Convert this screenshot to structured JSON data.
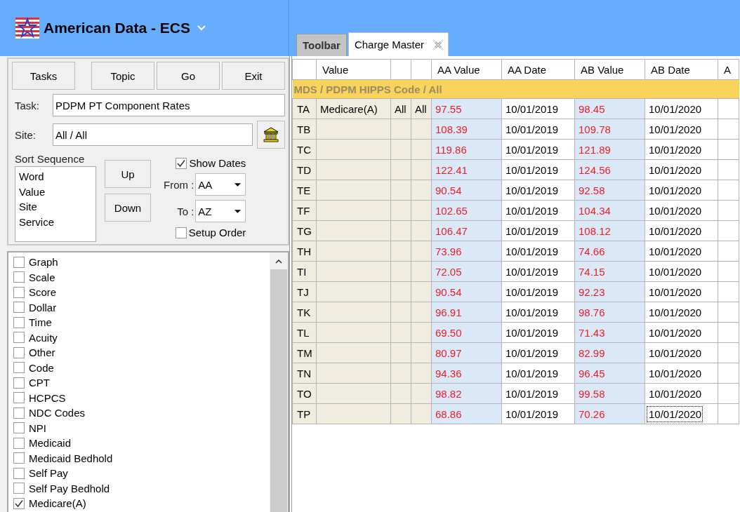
{
  "app": {
    "title": "American Data - ECS"
  },
  "tabs": [
    {
      "label": "Toolbar",
      "selected": false,
      "closable": false
    },
    {
      "label": "Charge Master",
      "selected": true,
      "closable": true
    }
  ],
  "buttons": [
    "Tasks",
    "Topic",
    "Go",
    "Exit"
  ],
  "task": {
    "label": "Task:",
    "value": "PDPM PT Component Rates"
  },
  "site": {
    "label": "Site:",
    "value": "All / All"
  },
  "sort": {
    "label": "Sort Sequence",
    "items": [
      "Word",
      "Value",
      "Site",
      "Service"
    ],
    "up": "Up",
    "down": "Down"
  },
  "show_dates": {
    "label": "Show Dates",
    "checked": true
  },
  "from": {
    "label": "From :",
    "value": "AA"
  },
  "to": {
    "label": "To :",
    "value": "AZ"
  },
  "setup_order": {
    "label": "Setup Order",
    "checked": false
  },
  "filters": [
    {
      "label": "Graph",
      "checked": false
    },
    {
      "label": "Scale",
      "checked": false
    },
    {
      "label": "Score",
      "checked": false
    },
    {
      "label": "Dollar",
      "checked": false
    },
    {
      "label": "Time",
      "checked": false
    },
    {
      "label": "Acuity",
      "checked": false
    },
    {
      "label": "Other",
      "checked": false
    },
    {
      "label": "Code",
      "checked": false
    },
    {
      "label": "CPT",
      "checked": false
    },
    {
      "label": "HCPCS",
      "checked": false
    },
    {
      "label": "NDC Codes",
      "checked": false
    },
    {
      "label": "NPI",
      "checked": false
    },
    {
      "label": "Medicaid",
      "checked": false
    },
    {
      "label": "Medicaid Bedhold",
      "checked": false
    },
    {
      "label": "Self Pay",
      "checked": false
    },
    {
      "label": "Self Pay Bedhold",
      "checked": false
    },
    {
      "label": "Medicare(A)",
      "checked": true
    }
  ],
  "table": {
    "columns": [
      {
        "kind": "code"
      },
      {
        "kind": "label",
        "label": "Value"
      },
      {
        "kind": "narrow"
      },
      {
        "kind": "narrow"
      },
      {
        "kind": "value",
        "label": "AA Value"
      },
      {
        "kind": "date",
        "label": "AA Date"
      },
      {
        "kind": "value",
        "label": "AB Value"
      },
      {
        "kind": "date",
        "label": "AB Date"
      },
      {
        "kind": "date",
        "label": "A"
      }
    ],
    "group": "MDS / PDPM HIPPS Code / All",
    "rows": [
      {
        "cells": [
          "TA",
          "Medicare(A)",
          "All",
          "All",
          "97.55",
          "10/01/2019",
          "98.45",
          "10/01/2020",
          null
        ],
        "focused": false
      },
      {
        "cells": [
          "TB",
          null,
          null,
          null,
          "108.39",
          "10/01/2019",
          "109.78",
          "10/01/2020",
          null
        ],
        "focused": false
      },
      {
        "cells": [
          "TC",
          null,
          null,
          null,
          "119.86",
          "10/01/2019",
          "121.89",
          "10/01/2020",
          null
        ],
        "focused": false
      },
      {
        "cells": [
          "TD",
          null,
          null,
          null,
          "122.41",
          "10/01/2019",
          "124.56",
          "10/01/2020",
          null
        ],
        "focused": false
      },
      {
        "cells": [
          "TE",
          null,
          null,
          null,
          "90.54",
          "10/01/2019",
          "92.58",
          "10/01/2020",
          null
        ],
        "focused": false
      },
      {
        "cells": [
          "TF",
          null,
          null,
          null,
          "102.65",
          "10/01/2019",
          "104.34",
          "10/01/2020",
          null
        ],
        "focused": false
      },
      {
        "cells": [
          "TG",
          null,
          null,
          null,
          "106.47",
          "10/01/2019",
          "108.12",
          "10/01/2020",
          null
        ],
        "focused": false
      },
      {
        "cells": [
          "TH",
          null,
          null,
          null,
          "73.96",
          "10/01/2019",
          "74.66",
          "10/01/2020",
          null
        ],
        "focused": false
      },
      {
        "cells": [
          "TI",
          null,
          null,
          null,
          "72.05",
          "10/01/2019",
          "74.15",
          "10/01/2020",
          null
        ],
        "focused": false
      },
      {
        "cells": [
          "TJ",
          null,
          null,
          null,
          "90.54",
          "10/01/2019",
          "92.23",
          "10/01/2020",
          null
        ],
        "focused": false
      },
      {
        "cells": [
          "TK",
          null,
          null,
          null,
          "96.91",
          "10/01/2019",
          "98.76",
          "10/01/2020",
          null
        ],
        "focused": false
      },
      {
        "cells": [
          "TL",
          null,
          null,
          null,
          "69.50",
          "10/01/2019",
          "71.43",
          "10/01/2020",
          null
        ],
        "focused": false
      },
      {
        "cells": [
          "TM",
          null,
          null,
          null,
          "80.97",
          "10/01/2019",
          "82.99",
          "10/01/2020",
          null
        ],
        "focused": false
      },
      {
        "cells": [
          "TN",
          null,
          null,
          null,
          "94.36",
          "10/01/2019",
          "96.45",
          "10/01/2020",
          null
        ],
        "focused": false
      },
      {
        "cells": [
          "TO",
          null,
          null,
          null,
          "98.82",
          "10/01/2019",
          "99.58",
          "10/01/2020",
          null
        ],
        "focused": false
      },
      {
        "cells": [
          "TP",
          null,
          null,
          null,
          "68.86",
          "10/01/2019",
          "70.26",
          "10/01/2020",
          null
        ],
        "focused": true
      }
    ]
  }
}
